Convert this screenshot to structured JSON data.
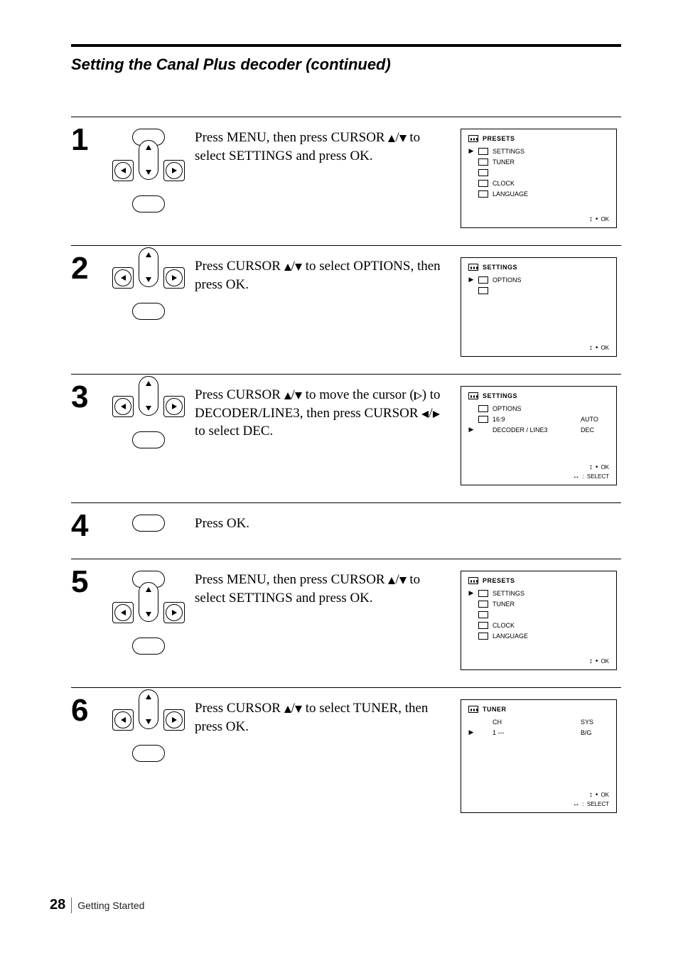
{
  "page_title": "Setting the Canal Plus decoder (continued)",
  "steps": [
    {
      "num": "1",
      "icons": [
        "menu",
        "dpad",
        "ok"
      ],
      "text_parts": [
        "Press MENU, then press CURSOR ",
        {
          "glyph": "up"
        },
        "/",
        {
          "glyph": "down"
        },
        " to select SETTINGS and press OK."
      ],
      "osd": {
        "type": "presets",
        "header_icon": "cassette",
        "title": "PRESETS",
        "rows": [
          {
            "mark": "▶",
            "icon": "film",
            "label": "SETTINGS"
          },
          {
            "mark": "",
            "icon": "antenna",
            "label": "TUNER"
          },
          {
            "mark": "",
            "icon": "clock-box",
            "label": ""
          },
          {
            "mark": "",
            "icon": "clock",
            "label": "CLOCK"
          },
          {
            "mark": "",
            "icon": "lang",
            "label": "LANGUAGE"
          }
        ],
        "foot": [
          [
            "ud",
            "dot",
            "OK"
          ]
        ]
      }
    },
    {
      "num": "2",
      "icons": [
        "dpad",
        "ok"
      ],
      "text_parts": [
        "Press CURSOR ",
        {
          "glyph": "up"
        },
        "/",
        {
          "glyph": "down"
        },
        " to select OPTIONS, then press OK."
      ],
      "osd": {
        "type": "settings",
        "header_icon": "film",
        "title": "SETTINGS",
        "rows": [
          {
            "mark": "▶",
            "icon": "video",
            "label": "OPTIONS"
          },
          {
            "mark": "",
            "icon": "switch",
            "label": ""
          }
        ],
        "foot": [
          [
            "ud",
            "dot",
            "OK"
          ]
        ]
      }
    },
    {
      "num": "3",
      "icons": [
        "dpad",
        "ok"
      ],
      "text_parts": [
        "Press CURSOR ",
        {
          "glyph": "up"
        },
        "/",
        {
          "glyph": "down"
        },
        " to move the cursor (",
        {
          "glyph": "play"
        },
        ") to DECODER/LINE3, then press CURSOR ",
        {
          "glyph": "left"
        },
        "/",
        {
          "glyph": "right"
        },
        " to select DEC."
      ],
      "osd": {
        "type": "options",
        "header_icon": "film",
        "title": "SETTINGS",
        "rows": [
          {
            "mark": "",
            "icon": "video",
            "label": "OPTIONS"
          },
          {
            "mark": "",
            "icon": "switch",
            "label": "16:9",
            "value": "AUTO"
          },
          {
            "mark": "▶",
            "icon": "",
            "label": "DECODER / LINE3",
            "value": "DEC"
          }
        ],
        "foot": [
          [
            "ud",
            "dot",
            "OK"
          ],
          [
            "lr",
            ":",
            "SELECT"
          ]
        ]
      }
    },
    {
      "num": "4",
      "icons": [
        "ok-only"
      ],
      "text_parts": [
        "Press OK."
      ],
      "osd": null
    },
    {
      "num": "5",
      "icons": [
        "menu",
        "dpad",
        "ok"
      ],
      "text_parts": [
        "Press MENU, then press CURSOR ",
        {
          "glyph": "up"
        },
        "/",
        {
          "glyph": "down"
        },
        " to select SETTINGS and press OK."
      ],
      "osd": {
        "type": "presets",
        "header_icon": "cassette",
        "title": "PRESETS",
        "rows": [
          {
            "mark": "▶",
            "icon": "film",
            "label": "SETTINGS"
          },
          {
            "mark": "",
            "icon": "antenna",
            "label": "TUNER"
          },
          {
            "mark": "",
            "icon": "clock-box",
            "label": ""
          },
          {
            "mark": "",
            "icon": "clock",
            "label": "CLOCK"
          },
          {
            "mark": "",
            "icon": "lang",
            "label": "LANGUAGE"
          }
        ],
        "foot": [
          [
            "ud",
            "dot",
            "OK"
          ]
        ]
      }
    },
    {
      "num": "6",
      "icons": [
        "dpad",
        "ok"
      ],
      "text_parts": [
        "Press CURSOR ",
        {
          "glyph": "up"
        },
        "/",
        {
          "glyph": "down"
        },
        " to select TUNER, then press OK."
      ],
      "osd": {
        "type": "tuner",
        "header_icon": "antenna",
        "title": "TUNER",
        "rows": [
          {
            "mark": "",
            "icon": "",
            "label": "CH",
            "value": "SYS"
          },
          {
            "mark": "▶",
            "icon": "",
            "label": "1  ---",
            "value": "B/G"
          }
        ],
        "foot": [
          [
            "ud",
            "dot",
            "OK"
          ],
          [
            "lr",
            ":",
            "SELECT"
          ]
        ]
      }
    }
  ],
  "footer": {
    "page_number": "28",
    "section": "Getting Started"
  }
}
